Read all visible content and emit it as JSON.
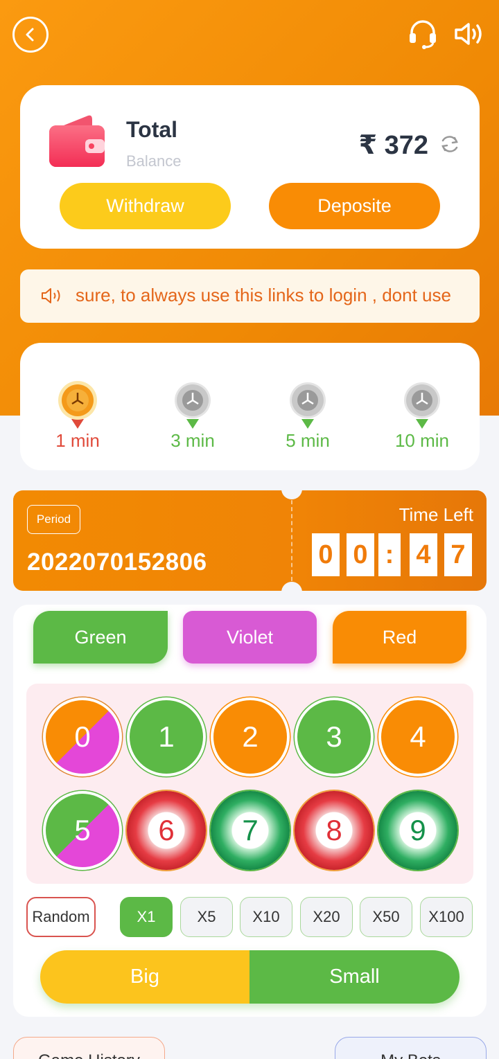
{
  "header": {
    "back_icon": "chevron-left-icon",
    "support_icon": "headset-icon",
    "sound_icon": "speaker-icon"
  },
  "wallet": {
    "title": "Total",
    "subtitle": "Balance",
    "currency": "₹",
    "amount": "372",
    "balance_text": "₹ 372",
    "withdraw_label": "Withdraw",
    "deposit_label": "Deposite"
  },
  "notice": {
    "text": "sure, to always use this links to login , dont use"
  },
  "game_tabs": [
    {
      "label": "1 min",
      "active": true
    },
    {
      "label": "3 min",
      "active": false
    },
    {
      "label": "5 min",
      "active": false
    },
    {
      "label": "10 min",
      "active": false
    }
  ],
  "period": {
    "badge": "Period",
    "number": "2022070152806",
    "time_left_label": "Time Left",
    "digits": [
      "0",
      "0",
      ":",
      "4",
      "7"
    ]
  },
  "colors": {
    "green_label": "Green",
    "violet_label": "Violet",
    "red_label": "Red",
    "green": "#5cb946",
    "violet": "#d85ad4",
    "orange": "#f98c05"
  },
  "numbers": [
    "0",
    "1",
    "2",
    "3",
    "4",
    "5",
    "6",
    "7",
    "8",
    "9"
  ],
  "multipliers": {
    "random_label": "Random",
    "options": [
      "X1",
      "X5",
      "X10",
      "X20",
      "X50",
      "X100"
    ],
    "selected": "X1"
  },
  "bigsmall": {
    "big_label": "Big",
    "small_label": "Small"
  },
  "history_tabs": [
    "Game History",
    "My Bets"
  ]
}
